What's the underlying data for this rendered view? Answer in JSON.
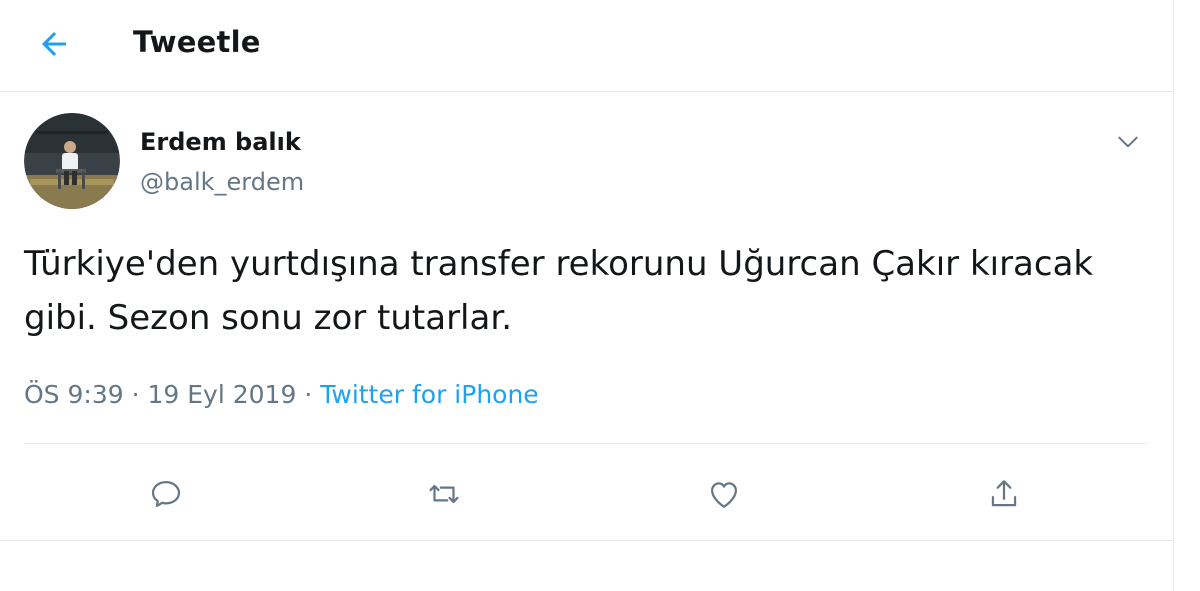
{
  "header": {
    "title": "Tweetle",
    "back_icon": "arrow-left-icon"
  },
  "colors": {
    "accent": "#1da1f2",
    "text_primary": "#14171a",
    "text_secondary": "#657786",
    "border": "#e6ecf0"
  },
  "tweet": {
    "author": {
      "display_name": "Erdem balık",
      "handle": "@balk_erdem"
    },
    "text": "Türkiye'den yurtdışına transfer rekorunu Uğurcan Çakır kıracak gibi. Sezon sonu zor tutarlar.",
    "time": "ÖS 9:39",
    "date": "19 Eyl 2019",
    "separator": "·",
    "source": "Twitter for iPhone",
    "more_icon": "chevron-down-icon"
  },
  "actions": [
    {
      "name": "reply",
      "icon": "comment-icon"
    },
    {
      "name": "retweet",
      "icon": "retweet-icon"
    },
    {
      "name": "like",
      "icon": "heart-icon"
    },
    {
      "name": "share",
      "icon": "share-icon"
    }
  ]
}
